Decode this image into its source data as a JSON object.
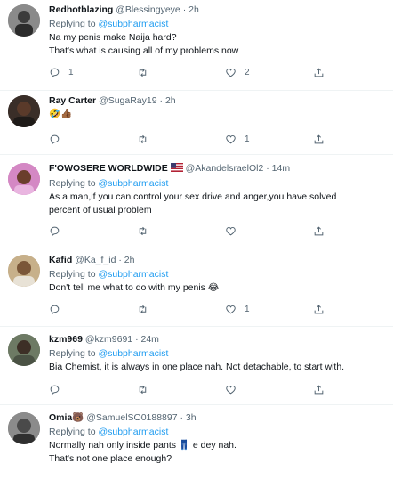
{
  "tweets": [
    {
      "name": "Redhotblazing",
      "handle": "@Blessingyeye",
      "sep": "·",
      "time": "2h",
      "replying_prefix": "Replying to ",
      "replying_to": "@subpharmacist",
      "lines": [
        "Na my penis make Naija hard?",
        "That's what is causing all of my problems now"
      ],
      "reply_count": "1",
      "retweet_count": "",
      "like_count": "2",
      "avatar_color": "#7a7a7a"
    },
    {
      "name": "Ray Carter",
      "handle": "@SugaRay19",
      "sep": "·",
      "time": "2h",
      "lines": [
        "🤣👍🏾"
      ],
      "reply_count": "",
      "retweet_count": "",
      "like_count": "1",
      "avatar_color": "#2c2420"
    },
    {
      "name": "F'OWOSERE WORLDWIDE",
      "flag": "us-flag-emoji",
      "handle": "@AkandelsraelOl2",
      "sep": "·",
      "time": "14m",
      "replying_prefix": "Replying to ",
      "replying_to": "@subpharmacist",
      "lines": [
        "As a man,if you can control your sex drive and anger,you have solved",
        "percent of usual problem"
      ],
      "reply_count": "",
      "retweet_count": "",
      "like_count": "",
      "avatar_color": "#c97fb8"
    },
    {
      "name": "Kafid",
      "handle": "@Ka_f_id",
      "sep": "·",
      "time": "2h",
      "replying_prefix": "Replying to ",
      "replying_to": "@subpharmacist",
      "lines": [
        "Don't tell me what to do with my penis 😂"
      ],
      "reply_count": "",
      "retweet_count": "",
      "like_count": "1",
      "avatar_color": "#b9a27e"
    },
    {
      "name": "kzm969",
      "handle": "@kzm9691",
      "sep": "·",
      "time": "24m",
      "replying_prefix": "Replying to ",
      "replying_to": "@subpharmacist",
      "lines": [
        "Bia Chemist, it is always in one place nah. Not detachable, to start with."
      ],
      "reply_count": "",
      "retweet_count": "",
      "like_count": "",
      "avatar_color": "#5f6b58"
    },
    {
      "name": "Omia🐻",
      "handle": "@SamuelSO0188897",
      "sep": "·",
      "time": "3h",
      "replying_prefix": "Replying to ",
      "replying_to": "@subpharmacist",
      "lines": [
        "Normally nah only inside pants 👖 e dey nah.",
        "That's not one place enough?"
      ],
      "avatar_color": "#6b6b6b"
    }
  ]
}
